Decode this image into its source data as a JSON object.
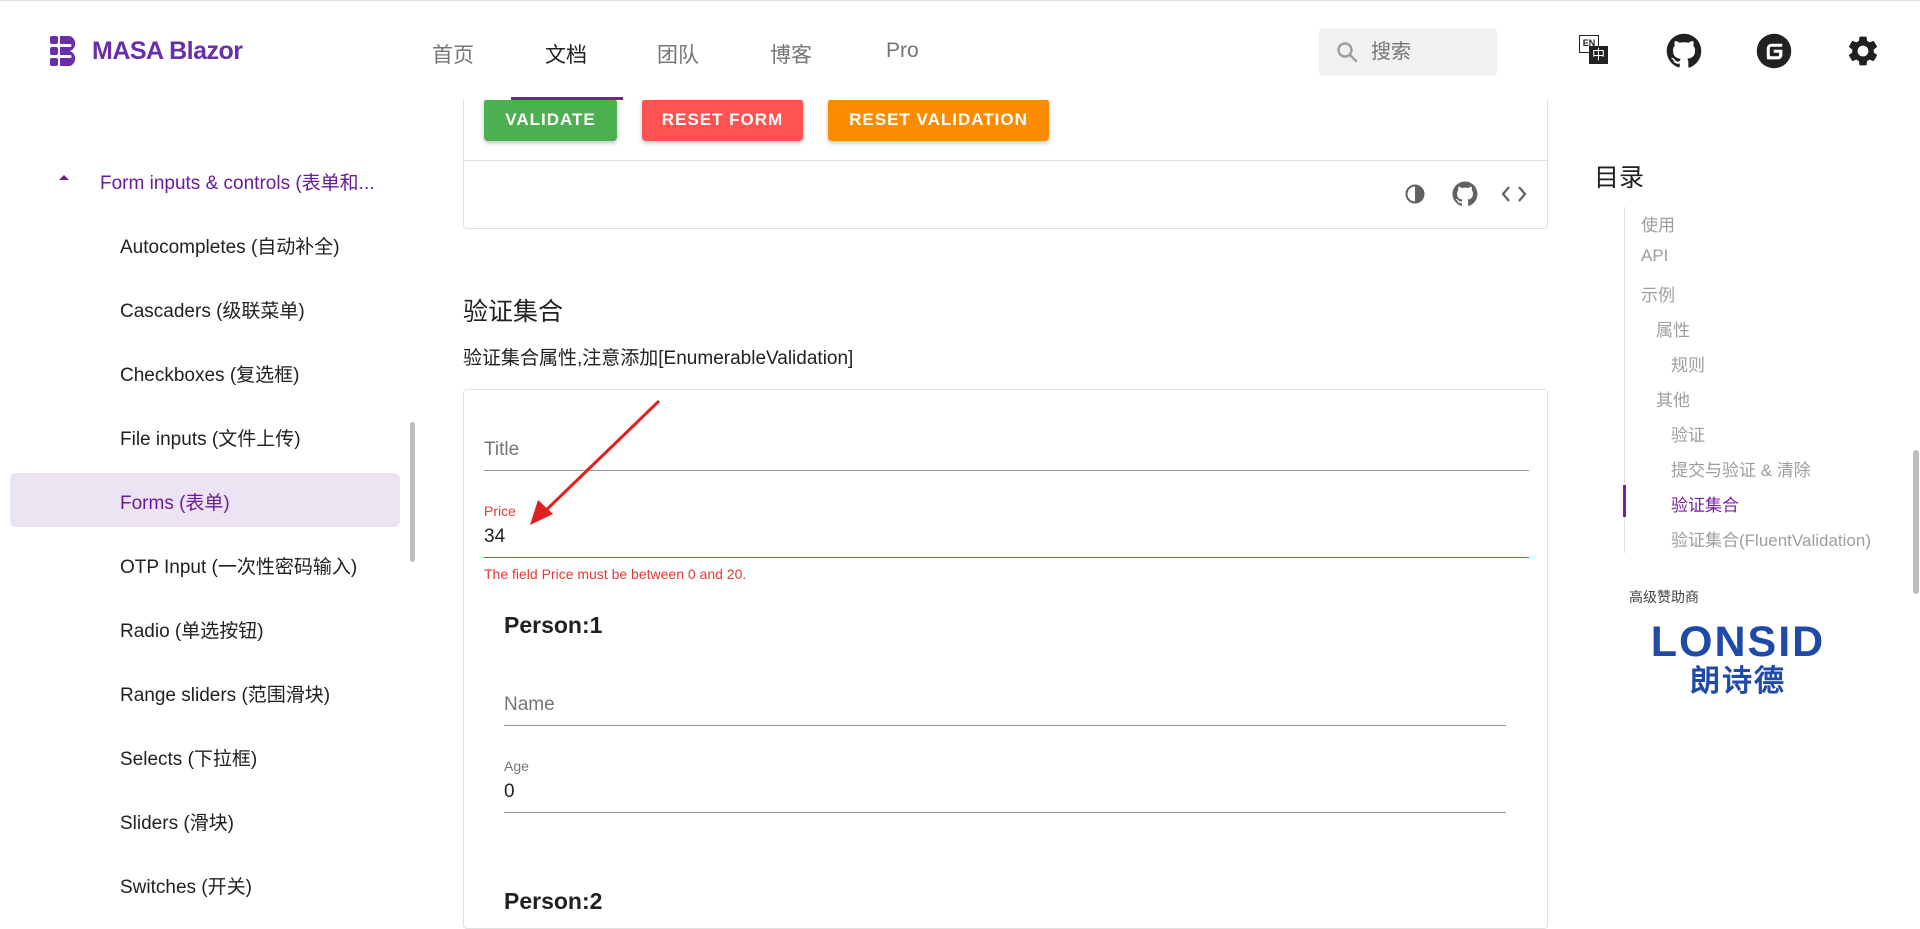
{
  "header": {
    "brand": "MASA Blazor",
    "nav": [
      "首页",
      "文档",
      "团队",
      "博客",
      "Pro"
    ],
    "search_placeholder": "搜索",
    "lang_icon_top": "EN",
    "lang_icon_bottom": "中"
  },
  "sidebar": {
    "group": "Form inputs & controls (表单和...",
    "items": [
      "Autocompletes (自动补全)",
      "Cascaders (级联菜单)",
      "Checkboxes (复选框)",
      "File inputs (文件上传)",
      "Forms (表单)",
      "OTP Input (一次性密码输入)",
      "Radio (单选按钮)",
      "Range sliders (范围滑块)",
      "Selects (下拉框)",
      "Sliders (滑块)",
      "Switches (开关)"
    ]
  },
  "example_top": {
    "buttons": [
      "VALIDATE",
      "RESET FORM",
      "RESET VALIDATION"
    ]
  },
  "section": {
    "title": "验证集合",
    "desc": "验证集合属性,注意添加[EnumerableValidation]"
  },
  "form": {
    "title_label": "Title",
    "price_label": "Price",
    "price_value": "34",
    "price_error": "The field Price must be between 0 and 20.",
    "person1_heading": "Person:1",
    "name_label": "Name",
    "age_label": "Age",
    "age_value": "0",
    "person2_heading": "Person:2"
  },
  "toc": {
    "title": "目录",
    "items": [
      "使用",
      "API",
      "示例",
      "属性",
      "规则",
      "其他",
      "验证",
      "提交与验证 & 清除",
      "验证集合",
      "验证集合(FluentValidation)"
    ],
    "active": "验证集合"
  },
  "sponsor": {
    "label": "高级赞助商",
    "logo_text": "LONSID",
    "logo_sub": "朗诗德"
  },
  "colors": {
    "brand": "#6a2fa8",
    "validate": "#4caf50",
    "reset": "#ff5252",
    "reset_validation": "#fb8c00",
    "error": "#e53935",
    "sponsor": "#1f4aa8"
  }
}
